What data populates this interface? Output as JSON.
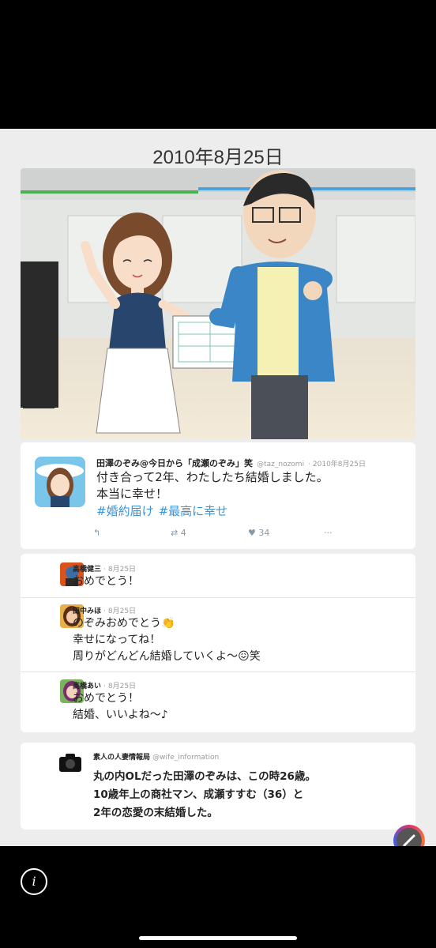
{
  "page": {
    "date_title": "2010年8月25日"
  },
  "tweet": {
    "display_name": "田澤のぞみ@今日から「成瀬のぞみ」笑",
    "handle": "@taz_nozomi",
    "date": "· 2010年8月25日",
    "text_line1": "付き合って2年、わたしたち結婚しました。",
    "text_line2": "本当に幸せ！",
    "hashtags": [
      "#婚約届け",
      "#最高に幸せ"
    ],
    "retweets": "4",
    "likes": "34"
  },
  "replies": [
    {
      "name": "高橋健三",
      "date": "· 8月25日",
      "lines": [
        "おめでとう！"
      ]
    },
    {
      "name": "田中みほ",
      "date": "· 8月25日",
      "lines": [
        "のぞみおめでとう👏",
        "幸せになってね！",
        "周りがどんどん結婚していくよ〜😖笑"
      ]
    },
    {
      "name": "高橋あい",
      "date": "· 8月25日",
      "lines": [
        "おめでとう！",
        "結婚、いいよね〜♪"
      ]
    }
  ],
  "info": {
    "name": "素人の人妻情報局",
    "handle": "@wife_information",
    "lines": [
      "丸の内OLだった田澤のぞみは、この時26歳。",
      "10歳年上の商社マン、成瀬すすむ（36）と",
      "2年の恋愛の末結婚した。"
    ]
  },
  "icons": {
    "reply": "reply-icon",
    "retweet": "retweet-icon",
    "like": "heart-icon",
    "more": "more-icon",
    "info": "info-icon",
    "edit": "pencil-icon"
  },
  "colors": {
    "hashtag": "#3b94d9",
    "background": "#ededee"
  }
}
